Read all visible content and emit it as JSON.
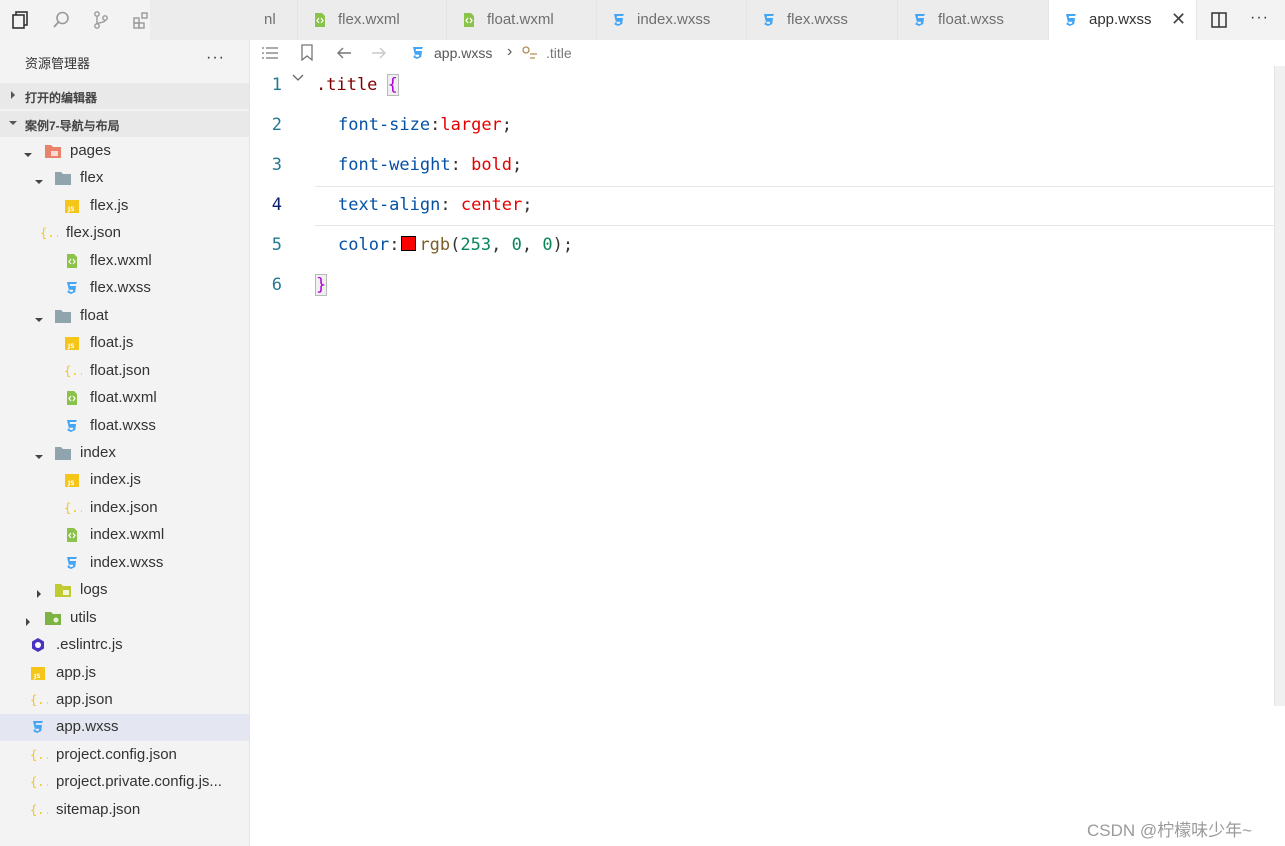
{
  "sidebar": {
    "explorer_title": "资源管理器",
    "explorer_more": "···",
    "sections": [
      {
        "label": "打开的编辑器"
      },
      {
        "label": "案例7-导航与布局"
      }
    ],
    "tree": [
      {
        "name": "pages",
        "icon": "folder-pages-icon"
      },
      {
        "name": "flex",
        "icon": "folder-icon"
      },
      {
        "name": "flex.js",
        "icon": "js-file-icon"
      },
      {
        "name": "flex.json",
        "icon": "json-file-icon"
      },
      {
        "name": "flex.wxml",
        "icon": "wxml-file-icon"
      },
      {
        "name": "flex.wxss",
        "icon": "wxss-file-icon"
      },
      {
        "name": "float",
        "icon": "folder-icon"
      },
      {
        "name": "float.js",
        "icon": "js-file-icon"
      },
      {
        "name": "float.json",
        "icon": "json-file-icon"
      },
      {
        "name": "float.wxml",
        "icon": "wxml-file-icon"
      },
      {
        "name": "float.wxss",
        "icon": "wxss-file-icon"
      },
      {
        "name": "index",
        "icon": "folder-icon"
      },
      {
        "name": "index.js",
        "icon": "js-file-icon"
      },
      {
        "name": "index.json",
        "icon": "json-file-icon"
      },
      {
        "name": "index.wxml",
        "icon": "wxml-file-icon"
      },
      {
        "name": "index.wxss",
        "icon": "wxss-file-icon"
      },
      {
        "name": "logs",
        "icon": "folder-logs-icon"
      },
      {
        "name": "utils",
        "icon": "folder-utils-icon"
      },
      {
        "name": ".eslintrc.js",
        "icon": "eslint-file-icon"
      },
      {
        "name": "app.js",
        "icon": "js-file-icon"
      },
      {
        "name": "app.json",
        "icon": "json-file-icon"
      },
      {
        "name": "app.wxss",
        "icon": "wxss-file-icon"
      },
      {
        "name": "project.config.json",
        "icon": "json-file-icon"
      },
      {
        "name": "project.private.config.js...",
        "icon": "json-file-icon"
      },
      {
        "name": "sitemap.json",
        "icon": "json-file-icon"
      }
    ]
  },
  "tabs": [
    {
      "name": "nl"
    },
    {
      "name": "flex.wxml"
    },
    {
      "name": "float.wxml"
    },
    {
      "name": "index.wxss"
    },
    {
      "name": "flex.wxss"
    },
    {
      "name": "float.wxss"
    },
    {
      "name": "app.wxss"
    }
  ],
  "tab_close": "✕",
  "tab_more": "···",
  "breadcrumb": {
    "file": "app.wxss",
    "separator": "›",
    "symbol": ".title"
  },
  "editor": {
    "line_numbers": [
      "1",
      "2",
      "3",
      "4",
      "5",
      "6"
    ],
    "line1": {
      "selector": ".title",
      "brace": "{"
    },
    "line2": {
      "prop": "font-size",
      "colon": ":",
      "value": "larger",
      "semi": ";"
    },
    "line3": {
      "prop": "font-weight",
      "colon": ": ",
      "value": "bold",
      "semi": ";"
    },
    "line4": {
      "prop": "text-align",
      "colon": ": ",
      "value": "center",
      "semi": ";"
    },
    "line5": {
      "prop": "color",
      "colon": ":",
      "fn": "rgb",
      "open": "(",
      "n1": "253",
      "c1": ", ",
      "n2": "0",
      "c2": ", ",
      "n3": "0",
      "close": ")",
      "semi": ";",
      "swatch_color": "#fd0000"
    },
    "line6": {
      "brace": "}"
    }
  },
  "watermark": "CSDN @柠檬味少年~",
  "colors": {
    "accent": "#4a90e2",
    "js_yellow": "#f5c518",
    "wxml_green": "#8bc34a",
    "wxss_blue": "#42a5f5"
  }
}
